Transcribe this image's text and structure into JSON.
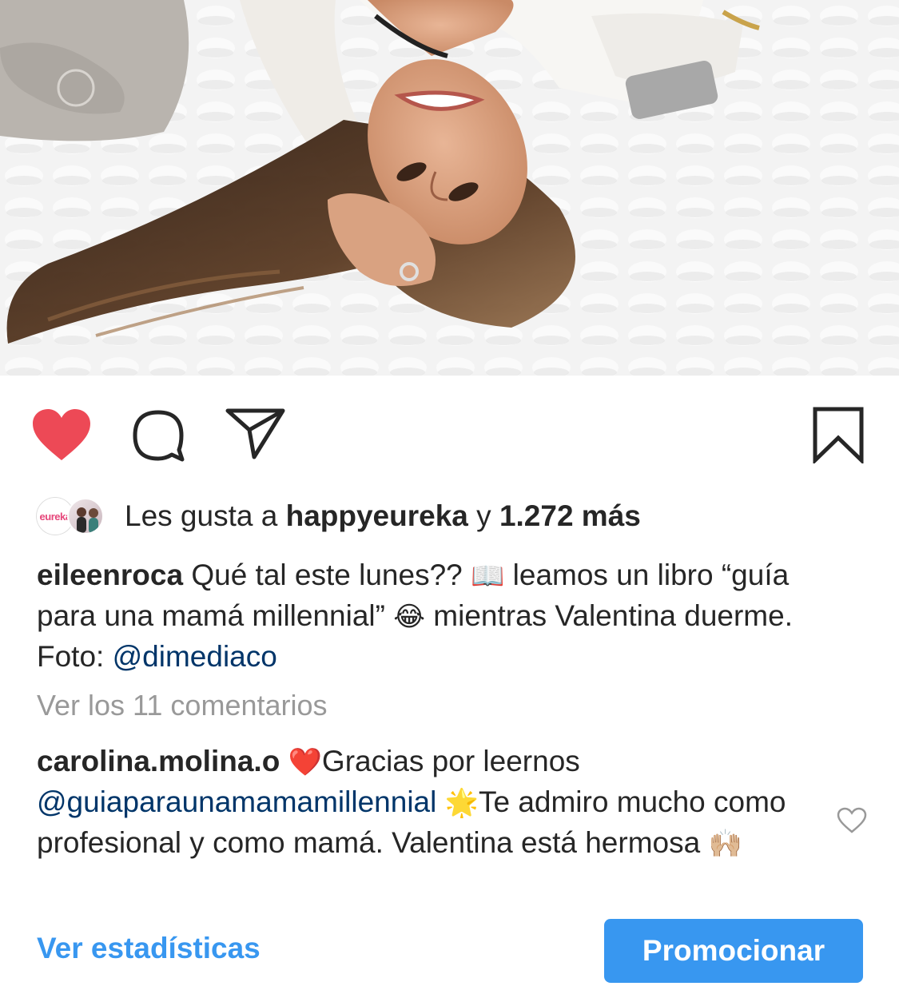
{
  "post": {
    "likes": {
      "prefix": "Les gusta a ",
      "user": "happyeureka",
      "connector": " y ",
      "count": "1.272 más",
      "avatar_text": "eureka"
    },
    "caption": {
      "username": "eileenroca",
      "text_1": " Qué tal este lunes?? ",
      "emoji_book": "📖",
      "text_2": " leamos un libro “guía para una mamá millennial” ",
      "emoji_laugh": "😂",
      "text_3": " mientras Valentina duerme.  Foto: ",
      "mention": "@dimediaco"
    },
    "view_comments": "Ver los 11 comentarios",
    "comment": {
      "username": "carolina.molina.o",
      "emoji_heart": "❤️",
      "text_1": "Gracias por leernos ",
      "mention": "@guiaparaunamamamillennial",
      "emoji_star": "🌟",
      "text_2": "Te admiro mucho como profesional y como mamá. Valentina está hermosa ",
      "emoji_hands": "🙌🏼"
    },
    "footer": {
      "stats_label": "Ver estadísticas",
      "promote_label": "Promocionar"
    }
  },
  "icons": {
    "like": "heart-icon",
    "comment": "comment-bubble-icon",
    "share": "paper-plane-icon",
    "save": "bookmark-icon",
    "comment_like": "heart-outline-icon"
  },
  "colors": {
    "heart_liked": "#ed4956",
    "link_blue": "#3897f0",
    "mention_blue": "#003569",
    "muted_gray": "#999999",
    "text": "#262626"
  },
  "state": {
    "liked": true
  }
}
